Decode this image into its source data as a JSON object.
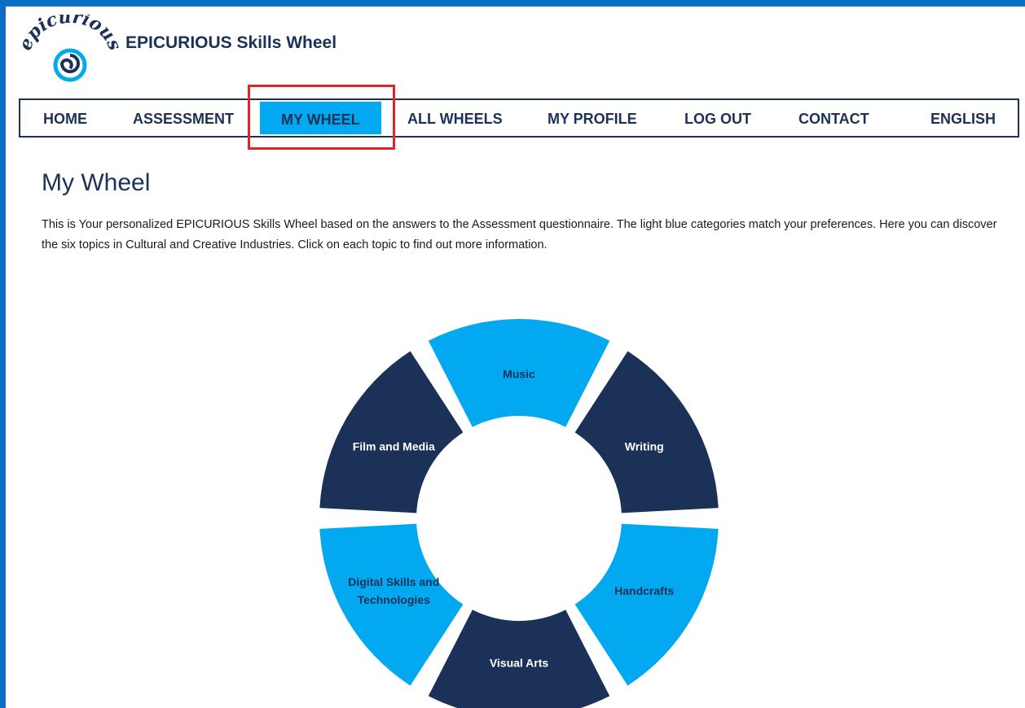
{
  "brand": {
    "logo_text": "epicurious",
    "site_title": "EPICURIOUS Skills Wheel",
    "primary_color": "#1b3158",
    "accent_color": "#03a9f0",
    "frame_color": "#0a6fc2"
  },
  "nav": {
    "items": [
      {
        "label": "HOME",
        "active": false
      },
      {
        "label": "ASSESSMENT",
        "active": false
      },
      {
        "label": "MY WHEEL",
        "active": true
      },
      {
        "label": "ALL WHEELS",
        "active": false
      },
      {
        "label": "MY PROFILE",
        "active": false
      },
      {
        "label": "LOG OUT",
        "active": false
      },
      {
        "label": "CONTACT",
        "active": false
      },
      {
        "label": "ENGLISH",
        "active": false
      }
    ],
    "highlight_color": "#e2232a"
  },
  "main": {
    "title": "My Wheel",
    "intro": "This is Your personalized EPICURIOUS Skills Wheel based on the answers to the Assessment questionnaire. The light blue categories match your prefer­ences. Here you can discover the six topics in Cultural and Creative Industries. Click on each topic to find out more information."
  },
  "wheel": {
    "segments": [
      {
        "label": "Music",
        "lines": [
          "Music"
        ],
        "highlighted": true
      },
      {
        "label": "Writing",
        "lines": [
          "Writing"
        ],
        "highlighted": false
      },
      {
        "label": "Handcrafts",
        "lines": [
          "Handcrafts"
        ],
        "highlighted": true
      },
      {
        "label": "Visual Arts",
        "lines": [
          "Visual Arts"
        ],
        "highlighted": false
      },
      {
        "label": "Digital Skills and Technologies",
        "lines": [
          "Digital Skills and",
          "Technologies"
        ],
        "highlighted": true
      },
      {
        "label": "Film and Media",
        "lines": [
          "Film and Media"
        ],
        "highlighted": false
      }
    ],
    "highlight_color": "#03a9f0",
    "default_color": "#1b3158"
  }
}
